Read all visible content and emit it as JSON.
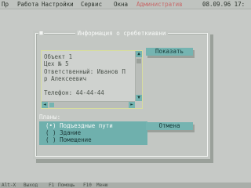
{
  "menu": {
    "items": [
      "Пр",
      "Работа",
      "Настройки",
      "Сервис",
      "Окна"
    ],
    "admin": "Административ",
    "date": "08.09.96 17:"
  },
  "dialog": {
    "title": "Информация о сребеткиавни",
    "close_glyph": "■",
    "memo": {
      "lines": [
        "Объект 1",
        "Цех № 5",
        "Ответственный: Иванов П",
        "р Алексеевич",
        "",
        "Телефон: 44-44-44"
      ]
    },
    "buttons": {
      "show": "Показать",
      "cancel": "Отмена"
    },
    "plans": {
      "label": "Планы:",
      "options": [
        {
          "mark": "(•)",
          "label": "Подъездные пути",
          "selected": true
        },
        {
          "mark": "( )",
          "label": "Здание",
          "selected": false
        },
        {
          "mark": "( )",
          "label": "Помещение",
          "selected": false
        }
      ]
    }
  },
  "status": {
    "items": [
      "Alt-X",
      "Выход",
      "F1",
      "Помощь",
      "F10",
      "Меню"
    ]
  },
  "colors": {
    "accent": "#75b4b1",
    "background": "#c6c9c6",
    "admin": "#c76a6a"
  }
}
